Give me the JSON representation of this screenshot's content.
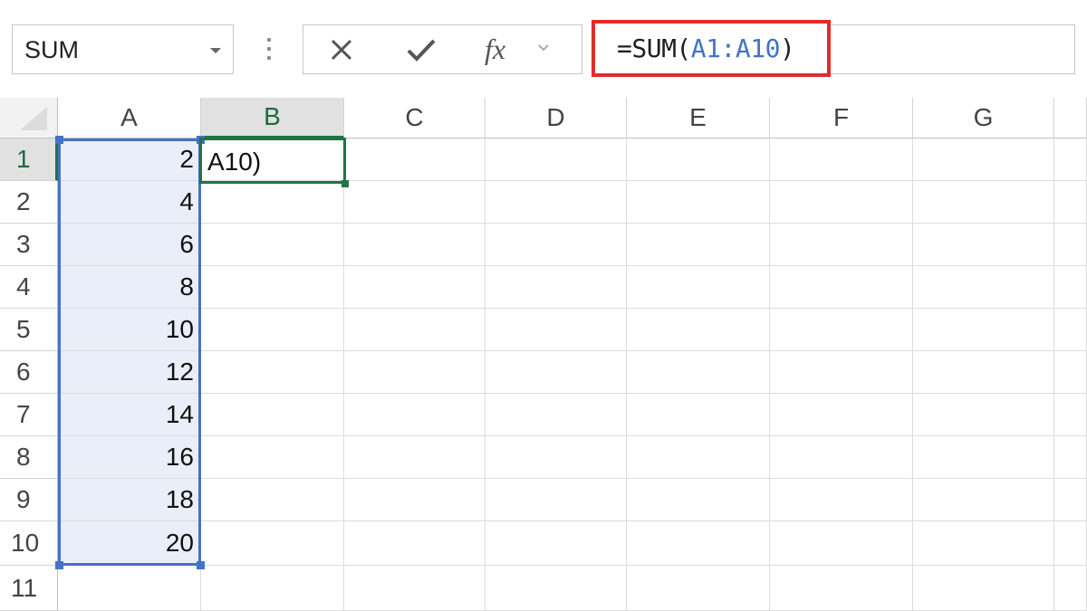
{
  "name_box": {
    "value": "SUM",
    "icon": "chevron-down-icon"
  },
  "formula_bar": {
    "cancel_icon": "close-icon",
    "enter_icon": "checkmark-icon",
    "fx_label": "fx",
    "formula_prefix": "=SUM(",
    "formula_ref": "A1:A10",
    "formula_suffix": ")"
  },
  "columns": [
    "A",
    "B",
    "C",
    "D",
    "E",
    "F",
    "G"
  ],
  "rows": [
    "1",
    "2",
    "3",
    "4",
    "5",
    "6",
    "7",
    "8",
    "9",
    "10",
    "11"
  ],
  "cells": {
    "A": [
      "2",
      "4",
      "6",
      "8",
      "10",
      "12",
      "14",
      "16",
      "18",
      "20",
      ""
    ],
    "B1": "A10)"
  },
  "active_cell": "B1",
  "selected_range": "A1:A10",
  "colors": {
    "highlight_border": "#e32b2b",
    "range_blue": "#4472c4",
    "active_green": "#217346",
    "range_fill": "#e9eef9"
  }
}
